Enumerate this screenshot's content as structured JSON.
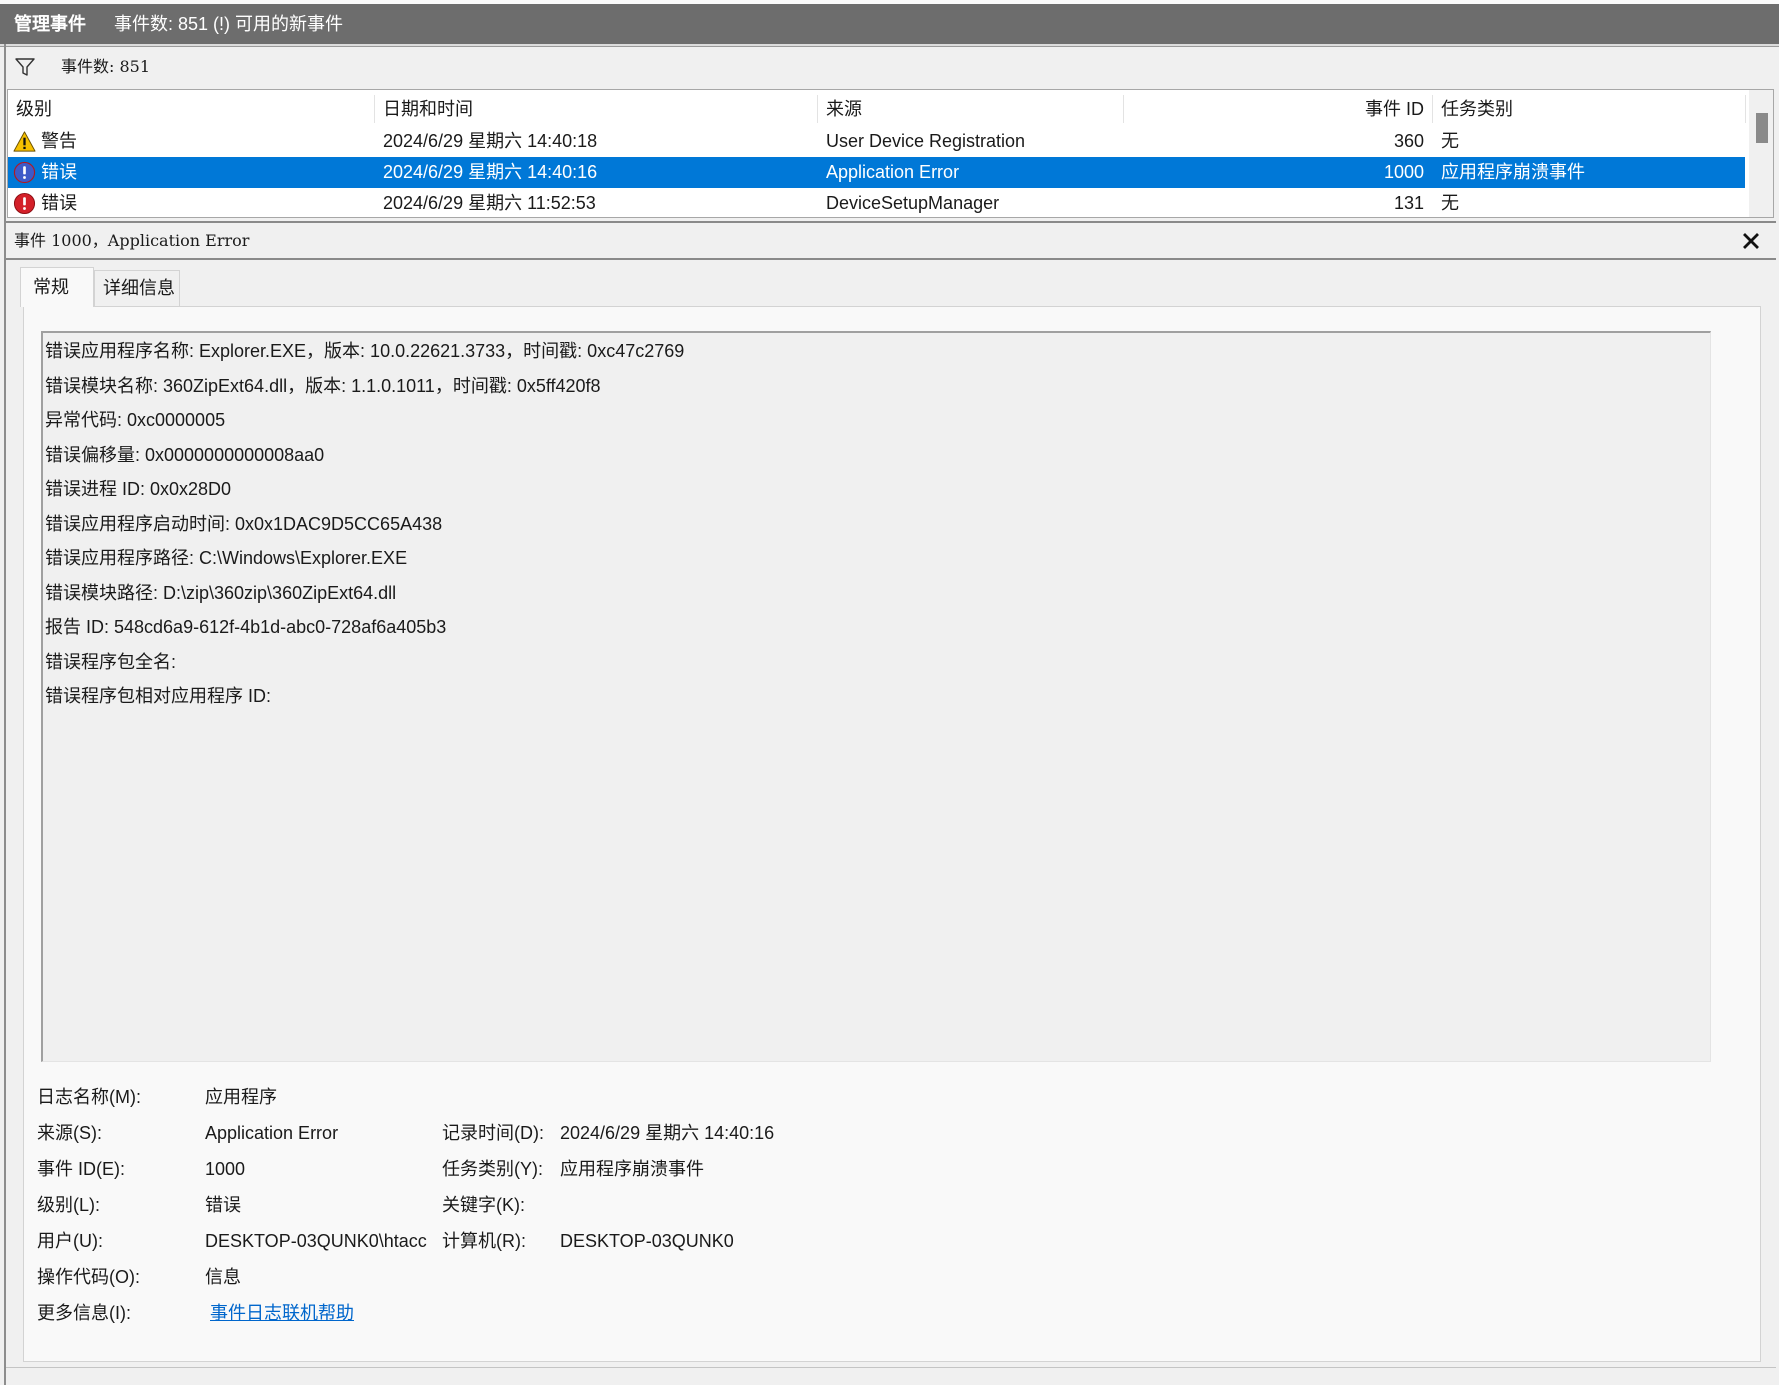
{
  "colors": {
    "title_bar": "#6d6d6d",
    "selection": "#0078d7",
    "link": "#0066cc",
    "warning": "#f6c000",
    "error": "#d32029"
  },
  "titlebar": {
    "title": "管理事件",
    "notice": "事件数: 851 (!) 可用的新事件"
  },
  "filter": {
    "icon": "funnel-icon",
    "count_label": "事件数: 851"
  },
  "events_table": {
    "columns": {
      "level": "级别",
      "datetime": "日期和时间",
      "source": "来源",
      "event_id": "事件 ID",
      "task_category": "任务类别"
    },
    "rows": [
      {
        "icon": "warning-icon",
        "level": "警告",
        "datetime": "2024/6/29 星期六 14:40:18",
        "source": "User Device Registration",
        "event_id": "360",
        "task_category": "无",
        "selected": false
      },
      {
        "icon": "error-icon",
        "level": "错误",
        "datetime": "2024/6/29 星期六 14:40:16",
        "source": "Application Error",
        "event_id": "1000",
        "task_category": "应用程序崩溃事件",
        "selected": true
      },
      {
        "icon": "error-icon",
        "level": "错误",
        "datetime": "2024/6/29 星期六 11:52:53",
        "source": "DeviceSetupManager",
        "event_id": "131",
        "task_category": "无",
        "selected": false
      }
    ]
  },
  "detail": {
    "title": "事件 1000，Application Error",
    "close_icon": "close-icon",
    "tabs": [
      {
        "label": "常规",
        "active": true
      },
      {
        "label": "详细信息",
        "active": false
      }
    ],
    "description": [
      "错误应用程序名称: Explorer.EXE，版本: 10.0.22621.3733，时间戳: 0xc47c2769",
      "错误模块名称: 360ZipExt64.dll，版本: 1.1.0.1011，时间戳: 0x5ff420f8",
      "异常代码: 0xc0000005",
      "错误偏移量: 0x0000000000008aa0",
      "错误进程 ID: 0x0x28D0",
      "错误应用程序启动时间: 0x0x1DAC9D5CC65A438",
      "错误应用程序路径: C:\\Windows\\Explorer.EXE",
      "错误模块路径: D:\\zip\\360zip\\360ZipExt64.dll",
      "报告 ID: 548cd6a9-612f-4b1d-abc0-728af6a405b3",
      "错误程序包全名:",
      "错误程序包相对应用程序 ID:"
    ],
    "properties": {
      "log_name": {
        "label": "日志名称(M):",
        "value": "应用程序"
      },
      "source": {
        "label": "来源(S):",
        "value": "Application Error"
      },
      "logged": {
        "label": "记录时间(D):",
        "value": "2024/6/29 星期六 14:40:16"
      },
      "event_id": {
        "label": "事件 ID(E):",
        "value": "1000"
      },
      "task_category": {
        "label": "任务类别(Y):",
        "value": "应用程序崩溃事件"
      },
      "level": {
        "label": "级别(L):",
        "value": "错误"
      },
      "keywords": {
        "label": "关键字(K):",
        "value": ""
      },
      "user": {
        "label": "用户(U):",
        "value": "DESKTOP-03QUNK0\\htacc"
      },
      "computer": {
        "label": "计算机(R):",
        "value": "DESKTOP-03QUNK0"
      },
      "opcode": {
        "label": "操作代码(O):",
        "value": "信息"
      },
      "more_info": {
        "label": "更多信息(I):",
        "link": "事件日志联机帮助"
      }
    }
  }
}
